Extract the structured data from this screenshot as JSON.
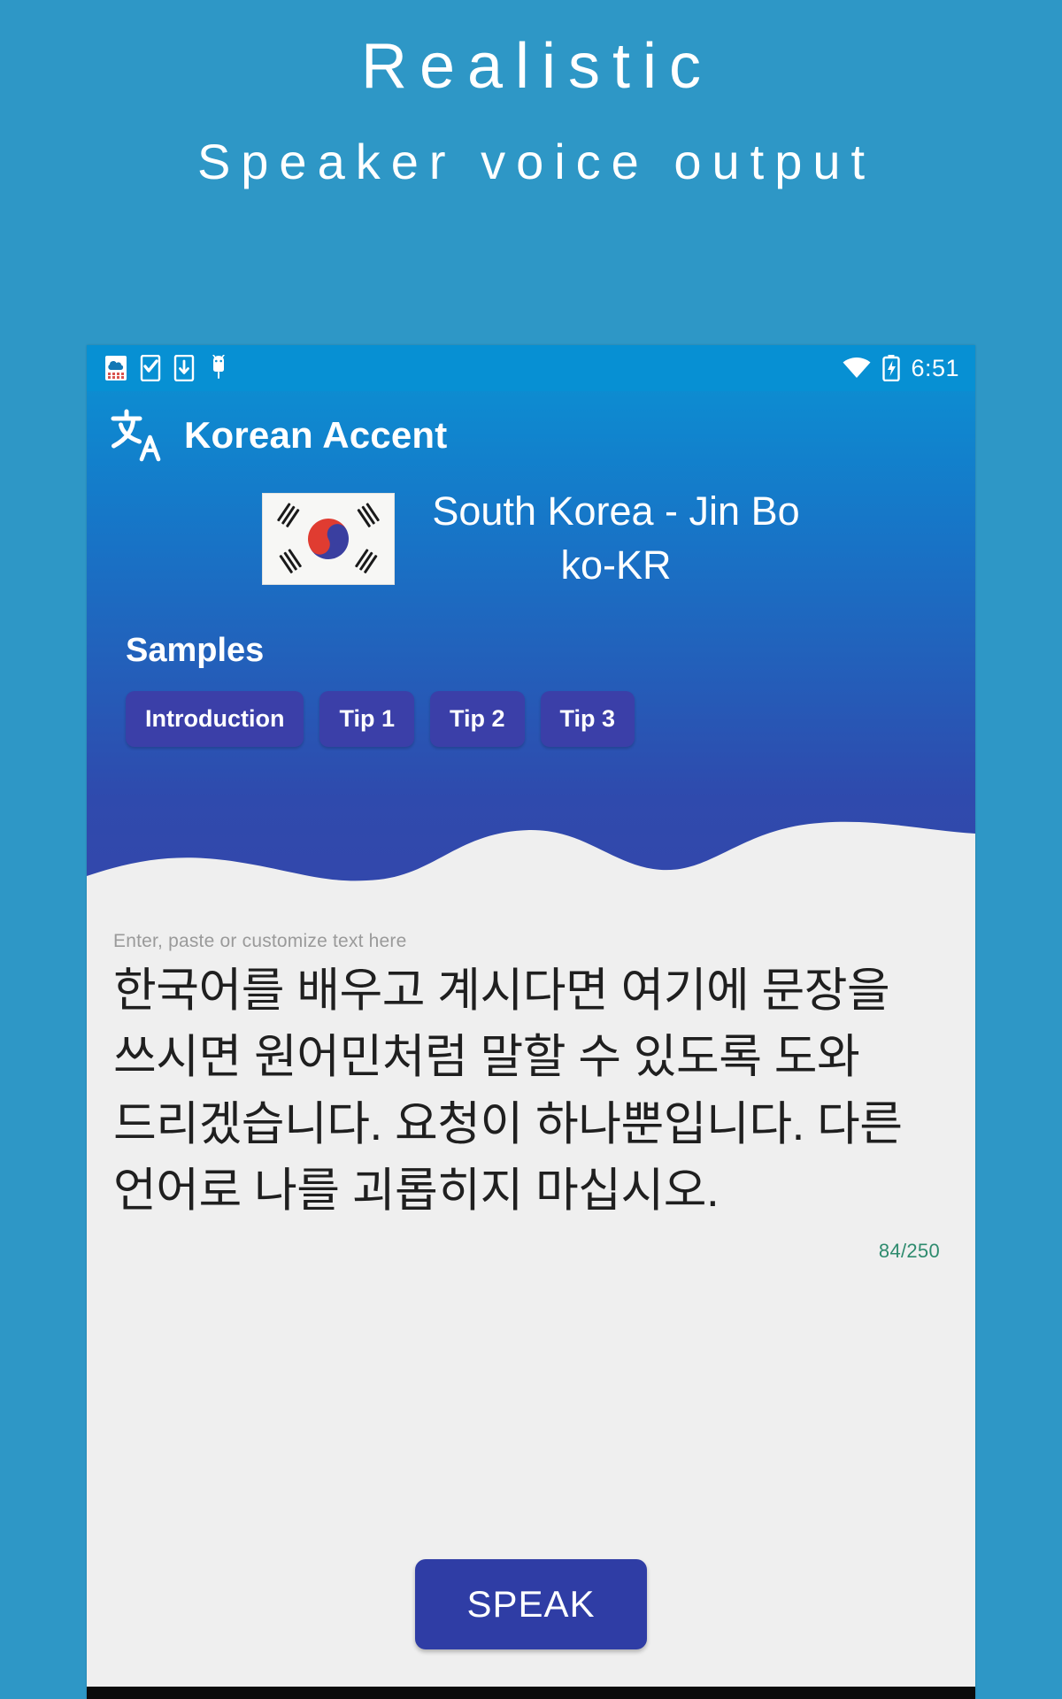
{
  "promo": {
    "title": "Realistic",
    "subtitle": "Speaker voice output"
  },
  "phone": {
    "status_bar": {
      "time": "6:51",
      "left_icons": [
        "weather-widget-icon",
        "task-checklist-icon",
        "download-icon",
        "android-robot-icon"
      ],
      "right_icons": [
        "wifi-icon",
        "battery-charging-icon"
      ]
    },
    "app_bar": {
      "icon": "translate-icon",
      "title": "Korean Accent"
    },
    "language": {
      "flag": "south-korea-flag",
      "name": "South Korea - Jin Bo",
      "code": "ko-KR"
    },
    "samples": {
      "title": "Samples",
      "chips": [
        {
          "label": "Introduction"
        },
        {
          "label": "Tip 1"
        },
        {
          "label": "Tip 2"
        },
        {
          "label": "Tip 3"
        }
      ]
    },
    "editor": {
      "hint": "Enter, paste or customize text here",
      "text": "한국어를 배우고 계시다면 여기에 문장을 쓰시면 원어민처럼 말할 수 있도록 도와 드리겠습니다. 요청이 하나뿐입니다. 다른 언어로 나를 괴롭히지 마십시오.",
      "counter": "84/250"
    },
    "speak_button": {
      "label": "SPEAK"
    }
  },
  "colors": {
    "promo_background": "#2e97c6",
    "header_top": "#0a93d4",
    "header_bottom": "#3447ab",
    "chip": "#3b3fa8",
    "speak_button": "#2f3da5",
    "counter_text": "#2e8b6e",
    "body_background": "#efefef"
  }
}
